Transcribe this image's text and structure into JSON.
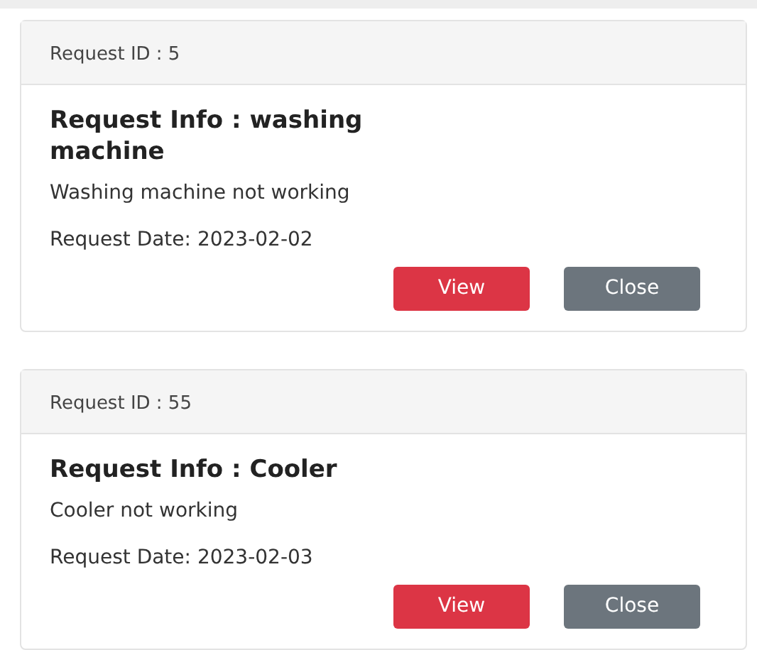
{
  "requests": [
    {
      "header": "Request ID : 5",
      "title": "Request Info : washing machine",
      "description": "Washing machine not working",
      "date": "Request Date: 2023-02-02",
      "buttons": [
        {
          "label": "View",
          "kind": "danger"
        },
        {
          "label": "Close",
          "kind": "secondary"
        }
      ]
    },
    {
      "header": "Request ID : 55",
      "title": "Request Info : Cooler",
      "description": "Cooler not working",
      "date": "Request Date: 2023-02-03",
      "buttons": [
        {
          "label": "View",
          "kind": "danger"
        },
        {
          "label": "Close",
          "kind": "secondary"
        }
      ]
    }
  ]
}
